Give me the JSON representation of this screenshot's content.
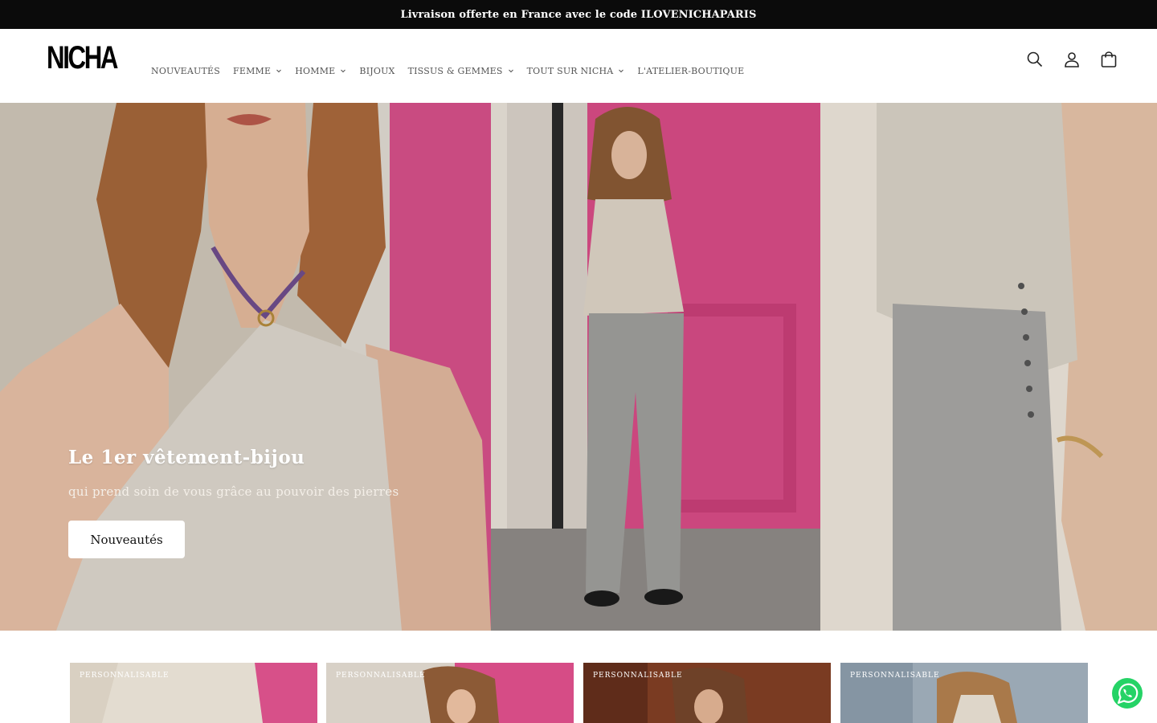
{
  "announcement": {
    "text": "Livraison offerte en France avec le code ILOVENICHAPARIS"
  },
  "header": {
    "logo_text": "NICHA",
    "nav": [
      {
        "label": "NOUVEAUTÉS",
        "has_dropdown": false
      },
      {
        "label": "FEMME",
        "has_dropdown": true
      },
      {
        "label": "HOMME",
        "has_dropdown": true
      },
      {
        "label": "BIJOUX",
        "has_dropdown": false
      },
      {
        "label": "TISSUS & GEMMES",
        "has_dropdown": true
      },
      {
        "label": "TOUT SUR NICHA",
        "has_dropdown": true
      },
      {
        "label": "L'ATELIER-BOUTIQUE",
        "has_dropdown": false
      }
    ],
    "icons": [
      "search-icon",
      "account-icon",
      "cart-icon"
    ]
  },
  "hero": {
    "title": "Le 1er vêtement-bijou",
    "subtitle": "qui prend soin de vous grâce au pouvoir des pierres",
    "button_label": "Nouveautés"
  },
  "products": [
    {
      "badge": "PERSONNALISABLE"
    },
    {
      "badge": "PERSONNALISABLE"
    },
    {
      "badge": "PERSONNALISABLE"
    },
    {
      "badge": "PERSONNALISABLE"
    }
  ],
  "colors": {
    "announcement_bg": "#0b0b0b",
    "hero_pink": "#d9568a",
    "whatsapp_green": "#25d366"
  }
}
